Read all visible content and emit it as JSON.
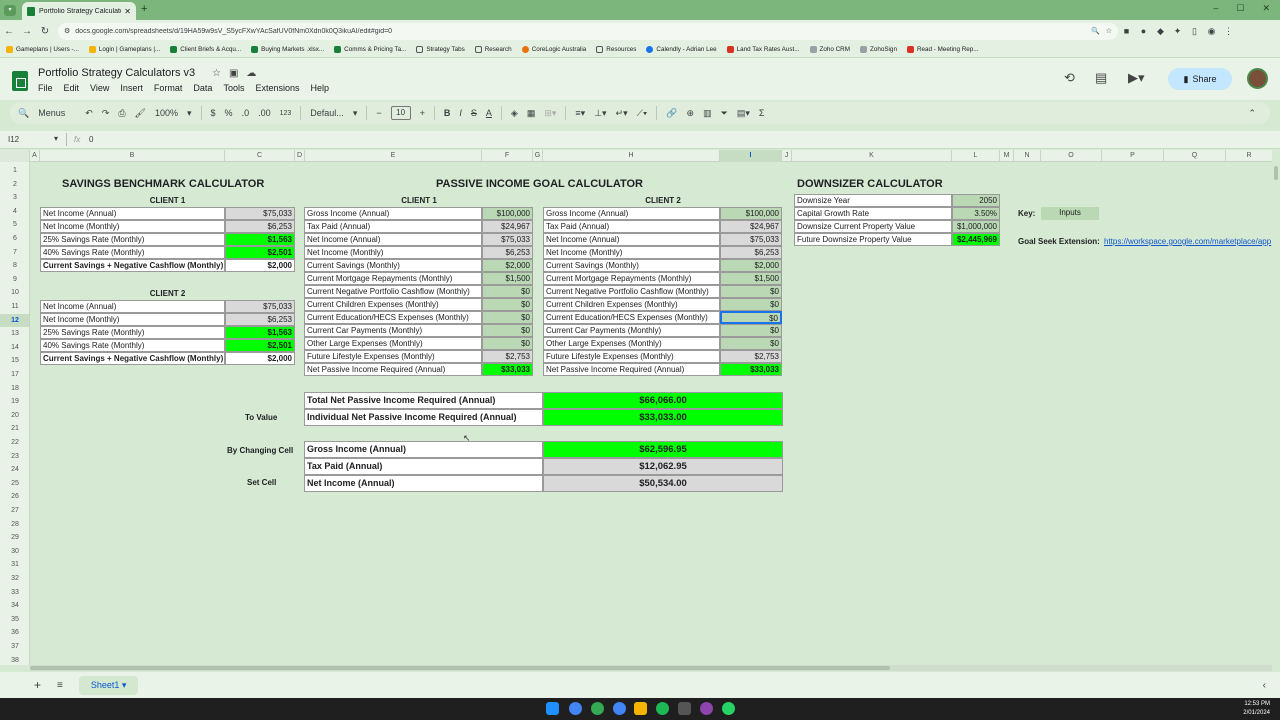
{
  "browser": {
    "tab_title": "Portfolio Strategy Calculators -",
    "url": "docs.google.com/spreadsheets/d/19HA59w9sV_S5ycFXwYAcSafUV0fNm0Xdn0k0Q3ikuAI/edit#gid=0",
    "bookmarks": [
      "Gameplans | Users -...",
      "Login | Gameplans |...",
      "Client Briefs & Acqu...",
      "Buying Markets .xlsx...",
      "Comms & Pricing Ta...",
      "Strategy Tabs",
      "Research",
      "CoreLogic Australia",
      "Resources",
      "Calendly - Adrian Lee",
      "Land Tax Rates Aust...",
      "Zoho CRM",
      "ZohoSign",
      "Read - Meeting Rep..."
    ]
  },
  "app": {
    "doc_title": "Portfolio Strategy Calculators v3",
    "menus": [
      "File",
      "Edit",
      "View",
      "Insert",
      "Format",
      "Data",
      "Tools",
      "Extensions",
      "Help"
    ],
    "share_label": "Share"
  },
  "toolbar": {
    "menus_label": "Menus",
    "zoom": "100%",
    "currency": "$",
    "percent": "%",
    "dec_minus": ".0",
    "dec_plus": ".00",
    "num_format": "123",
    "font": "Defaul...",
    "font_size": "10"
  },
  "formula_bar": {
    "cell_ref": "I12",
    "fx": "fx",
    "content": "0"
  },
  "columns": [
    "A",
    "B",
    "C",
    "D",
    "E",
    "F",
    "G",
    "H",
    "I",
    "J",
    "K",
    "L",
    "M",
    "N",
    "O",
    "P",
    "Q",
    "R"
  ],
  "rows": [
    "1",
    "2",
    "3",
    "4",
    "5",
    "6",
    "7",
    "8",
    "9",
    "10",
    "11",
    "12",
    "13",
    "14",
    "15",
    "17",
    "18",
    "19",
    "20",
    "21",
    "22",
    "23",
    "24",
    "25",
    "26",
    "27",
    "28",
    "29",
    "30",
    "31",
    "32",
    "33",
    "34",
    "35",
    "36",
    "37",
    "38"
  ],
  "savings": {
    "title": "SAVINGS BENCHMARK CALCULATOR",
    "client1_label": "CLIENT 1",
    "client2_label": "CLIENT 2",
    "client1": [
      {
        "label": "Net Income (Annual)",
        "value": "$75,033"
      },
      {
        "label": "Net Income (Monthly)",
        "value": "$6,253"
      },
      {
        "label": "25% Savings Rate (Monthly)",
        "value": "$1,563"
      },
      {
        "label": "40% Savings Rate (Monthly)",
        "value": "$2,501"
      },
      {
        "label": "Current Savings + Negative Cashflow (Monthly)",
        "value": "$2,000"
      }
    ],
    "client2": [
      {
        "label": "Net Income (Annual)",
        "value": "$75,033"
      },
      {
        "label": "Net Income (Monthly)",
        "value": "$6,253"
      },
      {
        "label": "25% Savings Rate (Monthly)",
        "value": "$1,563"
      },
      {
        "label": "40% Savings Rate (Monthly)",
        "value": "$2,501"
      },
      {
        "label": "Current Savings + Negative Cashflow (Monthly)",
        "value": "$2,000"
      }
    ]
  },
  "passive": {
    "title": "PASSIVE INCOME GOAL CALCULATOR",
    "client1_label": "CLIENT 1",
    "client2_label": "CLIENT 2",
    "client1": [
      {
        "label": "Gross Income (Annual)",
        "value": "$100,000"
      },
      {
        "label": "Tax Paid (Annual)",
        "value": "$24,967"
      },
      {
        "label": "Net Income (Annual)",
        "value": "$75,033"
      },
      {
        "label": "Net Income (Monthly)",
        "value": "$6,253"
      },
      {
        "label": "Current Savings (Monthly)",
        "value": "$2,000"
      },
      {
        "label": "Current Mortgage Repayments (Monthly)",
        "value": "$1,500"
      },
      {
        "label": "Current Negative Portfolio Cashflow (Monthly)",
        "value": "$0"
      },
      {
        "label": "Current Children Expenses (Monthly)",
        "value": "$0"
      },
      {
        "label": "Current Education/HECS Expenses (Monthly)",
        "value": "$0"
      },
      {
        "label": "Current Car Payments (Monthly)",
        "value": "$0"
      },
      {
        "label": "Other Large Expenses (Monthly)",
        "value": "$0"
      },
      {
        "label": "Future Lifestyle Expenses (Monthly)",
        "value": "$2,753"
      },
      {
        "label": "Net Passive Income Required (Annual)",
        "value": "$33,033"
      }
    ],
    "client2": [
      {
        "label": "Gross Income (Annual)",
        "value": "$100,000"
      },
      {
        "label": "Tax Paid (Annual)",
        "value": "$24,967"
      },
      {
        "label": "Net Income (Annual)",
        "value": "$75,033"
      },
      {
        "label": "Net Income (Monthly)",
        "value": "$6,253"
      },
      {
        "label": "Current Savings (Monthly)",
        "value": "$2,000"
      },
      {
        "label": "Current Mortgage Repayments (Monthly)",
        "value": "$1,500"
      },
      {
        "label": "Current Negative Portfolio Cashflow (Monthly)",
        "value": "$0"
      },
      {
        "label": "Current Children Expenses (Monthly)",
        "value": "$0"
      },
      {
        "label": "Current Education/HECS Expenses (Monthly)",
        "value": "$0"
      },
      {
        "label": "Current Car Payments (Monthly)",
        "value": "$0"
      },
      {
        "label": "Other Large Expenses (Monthly)",
        "value": "$0"
      },
      {
        "label": "Future Lifestyle Expenses (Monthly)",
        "value": "$2,753"
      },
      {
        "label": "Net Passive Income Required (Annual)",
        "value": "$33,033"
      }
    ],
    "totals": [
      {
        "label": "Total Net Passive Income Required (Annual)",
        "value": "$66,066.00"
      },
      {
        "label": "Individual Net Passive Income Required (Annual)",
        "value": "$33,033.00"
      }
    ],
    "goalseek": [
      {
        "label": "Gross Income (Annual)",
        "value": "$62,596.95"
      },
      {
        "label": "Tax Paid (Annual)",
        "value": "$12,062.95"
      },
      {
        "label": "Net Income (Annual)",
        "value": "$50,534.00"
      }
    ],
    "side_labels": {
      "to_value": "To Value",
      "by_changing": "By Changing Cell",
      "set_cell": "Set Cell"
    }
  },
  "downsizer": {
    "title": "DOWNSIZER CALCULATOR",
    "rows": [
      {
        "label": "Downsize Year",
        "value": "2050"
      },
      {
        "label": "Capital Growth Rate",
        "value": "3.50%"
      },
      {
        "label": "Downsize Current Property Value",
        "value": "$1,000,000"
      },
      {
        "label": "Future Downsize Property Value",
        "value": "$2,445,969"
      }
    ],
    "key_label": "Key:",
    "key_inputs": "Inputs",
    "goal_seek_label": "Goal Seek Extension:",
    "goal_seek_link": "https://workspace.google.com/marketplace/app"
  },
  "sheet_tab": "Sheet1",
  "clock": {
    "time": "12:53 PM",
    "date": "2/01/2024"
  },
  "colors": {
    "input": "#b9d8b3",
    "highlight": "#00ff00",
    "background": "#d6e9d3"
  }
}
